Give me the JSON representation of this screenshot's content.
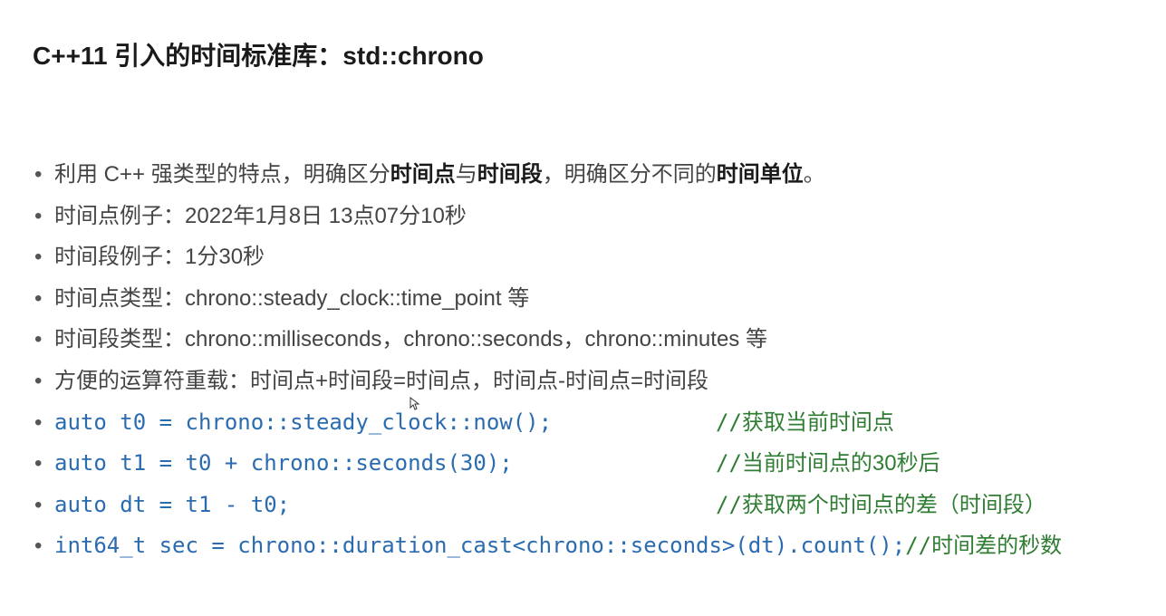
{
  "title": "C++11 引入的时间标准库：std::chrono",
  "bullets": {
    "b1_pre": "利用 C++ 强类型的特点，明确区分",
    "b1_bold1": "时间点",
    "b1_mid1": "与",
    "b1_bold2": "时间段",
    "b1_mid2": "，明确区分不同的",
    "b1_bold3": "时间单位",
    "b1_post": "。",
    "b2": "时间点例子：2022年1月8日 13点07分10秒",
    "b3": "时间段例子：1分30秒",
    "b4": "时间点类型：chrono::steady_clock::time_point 等",
    "b5": "时间段类型：chrono::milliseconds，chrono::seconds，chrono::minutes 等",
    "b6": "方便的运算符重载：时间点+时间段=时间点，时间点-时间点=时间段"
  },
  "codes": {
    "c1": "auto t0 = chrono::steady_clock::now();",
    "c1_comment_slash": "// ",
    "c1_comment": "获取当前时间点",
    "c2": "auto t1 = t0 + chrono::seconds(30);",
    "c2_comment_slash": "// ",
    "c2_comment": "当前时间点的30秒后",
    "c3": "auto dt = t1 - t0;",
    "c3_comment_slash": "// ",
    "c3_comment": "获取两个时间点的差（时间段）",
    "c4": "int64_t sec = chrono::duration_cast<chrono::seconds>(dt).count();",
    "c4_comment_slash": "  // ",
    "c4_comment": "时间差的秒数"
  },
  "watermark": ""
}
